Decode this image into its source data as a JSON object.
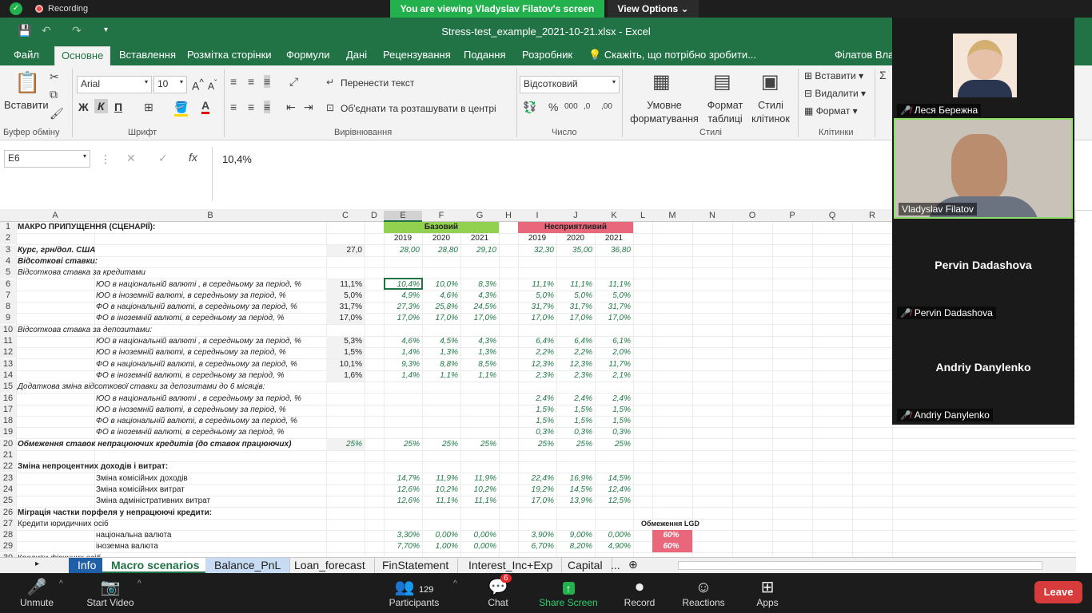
{
  "zoom_top": {
    "recording": "Recording",
    "viewing": "You are viewing Vladyslav Filatov's screen",
    "view_options": "View Options"
  },
  "excel": {
    "title": "Stress-test_example_2021-10-21.xlsx - Excel",
    "menu": [
      "Файл",
      "Основне",
      "Вставлення",
      "Розмітка сторінки",
      "Формули",
      "Дані",
      "Рецензування",
      "Подання",
      "Розробник"
    ],
    "tell_me": "Скажіть, що потрібно зробити...",
    "user": "Філатов Вла",
    "ribbon": {
      "paste": "Вставити",
      "clipboard": "Буфер обміну",
      "font_name": "Arial",
      "font_size": "10",
      "font": "Шрифт",
      "bold": "Ж",
      "italic": "К",
      "underline": "П",
      "wrap": "Перенести текст",
      "merge": "Об'єднати та розташувати в центрі",
      "alignment": "Вирівнювання",
      "number_format": "Відсотковий",
      "number": "Число",
      "cond_format": "Умовне форматування",
      "format_table": "Формат таблиці",
      "cell_styles": "Стилі клітинок",
      "styles": "Стилі",
      "insert": "Вставити",
      "delete": "Видалити",
      "format": "Формат",
      "cells": "Клітинки"
    },
    "name_box": "E6",
    "formula": "10,4%",
    "columns": [
      "A",
      "B",
      "C",
      "D",
      "E",
      "F",
      "G",
      "H",
      "I",
      "J",
      "K",
      "L",
      "M",
      "N",
      "O",
      "P",
      "Q",
      "R"
    ],
    "headers": {
      "base": "Базовий",
      "adverse": "Несприятливий",
      "years": [
        "2019",
        "2020",
        "2021"
      ],
      "lgd": "Обмеження LGD"
    },
    "rows": [
      {
        "n": "1",
        "a": "МАКРО ПРИПУЩЕННЯ (СЦЕНАРІЇ):",
        "b": "",
        "c": "",
        "e": "",
        "f": "",
        "g": "",
        "i": "",
        "j": "",
        "k": ""
      },
      {
        "n": "2",
        "a": "",
        "b": "",
        "c": "",
        "e": "",
        "f": "",
        "g": "",
        "i": "",
        "j": "",
        "k": ""
      },
      {
        "n": "3",
        "a": "Курс, грн/дол. США",
        "b": "",
        "c": "27,0",
        "e": "28,00",
        "f": "28,80",
        "g": "29,10",
        "i": "32,30",
        "j": "35,00",
        "k": "36,80"
      },
      {
        "n": "4",
        "a": "Відсоткові ставки:",
        "b": "",
        "c": "",
        "e": "",
        "f": "",
        "g": "",
        "i": "",
        "j": "",
        "k": ""
      },
      {
        "n": "5",
        "a": "Відсоткова ставка за кредитами",
        "b": "",
        "c": "",
        "e": "",
        "f": "",
        "g": "",
        "i": "",
        "j": "",
        "k": ""
      },
      {
        "n": "6",
        "a": "",
        "b": "ЮО в національній валюті , в середньому за період, %",
        "c": "11,1%",
        "e": "10,4%",
        "f": "10,0%",
        "g": "8,3%",
        "i": "11,1%",
        "j": "11,1%",
        "k": "11,1%"
      },
      {
        "n": "7",
        "a": "",
        "b": "ЮО в іноземній валюті, в середньому за період, %",
        "c": "5,0%",
        "e": "4,9%",
        "f": "4,6%",
        "g": "4,3%",
        "i": "5,0%",
        "j": "5,0%",
        "k": "5,0%"
      },
      {
        "n": "8",
        "a": "",
        "b": "ФО в національній валюті, в середньому за період, %",
        "c": "31,7%",
        "e": "27,3%",
        "f": "25,8%",
        "g": "24,5%",
        "i": "31,7%",
        "j": "31,7%",
        "k": "31,7%"
      },
      {
        "n": "9",
        "a": "",
        "b": "ФО в іноземній валюті, в середньому за період, %",
        "c": "17,0%",
        "e": "17,0%",
        "f": "17,0%",
        "g": "17,0%",
        "i": "17,0%",
        "j": "17,0%",
        "k": "17,0%"
      },
      {
        "n": "10",
        "a": "Відсоткова ставка за депозитами:",
        "b": "",
        "c": "",
        "e": "",
        "f": "",
        "g": "",
        "i": "",
        "j": "",
        "k": ""
      },
      {
        "n": "11",
        "a": "",
        "b": "ЮО в національній валюті , в середньому за період, %",
        "c": "5,3%",
        "e": "4,6%",
        "f": "4,5%",
        "g": "4,3%",
        "i": "6,4%",
        "j": "6,4%",
        "k": "6,1%"
      },
      {
        "n": "12",
        "a": "",
        "b": "ЮО в іноземній валюті, в середньому за період, %",
        "c": "1,5%",
        "e": "1,4%",
        "f": "1,3%",
        "g": "1,3%",
        "i": "2,2%",
        "j": "2,2%",
        "k": "2,0%"
      },
      {
        "n": "13",
        "a": "",
        "b": "ФО в національній валюті, в середньому за період, %",
        "c": "10,1%",
        "e": "9,3%",
        "f": "8,8%",
        "g": "8,5%",
        "i": "12,3%",
        "j": "12,3%",
        "k": "11,7%"
      },
      {
        "n": "14",
        "a": "",
        "b": "ФО в іноземній валюті, в середньому за період, %",
        "c": "1,6%",
        "e": "1,4%",
        "f": "1,1%",
        "g": "1,1%",
        "i": "2,3%",
        "j": "2,3%",
        "k": "2,1%"
      },
      {
        "n": "15",
        "a": "Додаткова зміна відсоткової ставки за депозитами до 6 місяців:",
        "b": "",
        "c": "",
        "e": "",
        "f": "",
        "g": "",
        "i": "",
        "j": "",
        "k": ""
      },
      {
        "n": "16",
        "a": "",
        "b": "ЮО в національній валюті , в середньому за період, %",
        "c": "",
        "e": "",
        "f": "",
        "g": "",
        "i": "2,4%",
        "j": "2,4%",
        "k": "2,4%"
      },
      {
        "n": "17",
        "a": "",
        "b": "ЮО в іноземній валюті, в середньому за період, %",
        "c": "",
        "e": "",
        "f": "",
        "g": "",
        "i": "1,5%",
        "j": "1,5%",
        "k": "1,5%"
      },
      {
        "n": "18",
        "a": "",
        "b": "ФО в національній валюті, в середньому за період, %",
        "c": "",
        "e": "",
        "f": "",
        "g": "",
        "i": "1,5%",
        "j": "1,5%",
        "k": "1,5%"
      },
      {
        "n": "19",
        "a": "",
        "b": "ФО в іноземній валюті, в середньому за період, %",
        "c": "",
        "e": "",
        "f": "",
        "g": "",
        "i": "0,3%",
        "j": "0,3%",
        "k": "0,3%"
      },
      {
        "n": "20",
        "a": "Обмеження ставок непрацюючих кредитів (до ставок працюючих)",
        "b": "",
        "c": "25%",
        "e": "25%",
        "f": "25%",
        "g": "25%",
        "i": "25%",
        "j": "25%",
        "k": "25%"
      },
      {
        "n": "21",
        "a": "",
        "b": "",
        "c": "",
        "e": "",
        "f": "",
        "g": "",
        "i": "",
        "j": "",
        "k": ""
      },
      {
        "n": "22",
        "a": "Зміна непроцентних доходів і витрат:",
        "b": "",
        "c": "",
        "e": "",
        "f": "",
        "g": "",
        "i": "",
        "j": "",
        "k": ""
      },
      {
        "n": "23",
        "a": "",
        "b": "Зміна комісійних доходів",
        "c": "",
        "e": "14,7%",
        "f": "11,9%",
        "g": "11,9%",
        "i": "22,4%",
        "j": "16,9%",
        "k": "14,5%"
      },
      {
        "n": "24",
        "a": "",
        "b": "Зміна комісійних витрат",
        "c": "",
        "e": "12,6%",
        "f": "10,2%",
        "g": "10,2%",
        "i": "19,2%",
        "j": "14,5%",
        "k": "12,4%"
      },
      {
        "n": "25",
        "a": "",
        "b": "Зміна адміністративних витрат",
        "c": "",
        "e": "12,6%",
        "f": "11,1%",
        "g": "11,1%",
        "i": "17,0%",
        "j": "13,9%",
        "k": "12,5%"
      },
      {
        "n": "26",
        "a": "Міграція частки порфеля у непрацюючі кредити:",
        "b": "",
        "c": "",
        "e": "",
        "f": "",
        "g": "",
        "i": "",
        "j": "",
        "k": ""
      },
      {
        "n": "27",
        "a": "Кредити юридичних осіб",
        "b": "",
        "c": "",
        "e": "",
        "f": "",
        "g": "",
        "i": "",
        "j": "",
        "k": ""
      },
      {
        "n": "28",
        "a": "",
        "b": "національна валюта",
        "c": "",
        "e": "3,30%",
        "f": "0,00%",
        "g": "0,00%",
        "i": "3,90%",
        "j": "9,00%",
        "k": "0,00%",
        "m": "60%"
      },
      {
        "n": "29",
        "a": "",
        "b": "іноземна валюта",
        "c": "",
        "e": "7,70%",
        "f": "1,00%",
        "g": "0,00%",
        "i": "6,70%",
        "j": "8,20%",
        "k": "4,90%",
        "m": "60%"
      },
      {
        "n": "30",
        "a": "Кредити фізичних осіб",
        "b": "",
        "c": "",
        "e": "",
        "f": "",
        "g": "",
        "i": "",
        "j": "",
        "k": ""
      }
    ],
    "sheet_tabs": [
      "Info",
      "Macro scenarios",
      "Balance_PnL",
      "Loan_forecast",
      "FinStatement",
      "Interest_Inc+Exp",
      "Capital",
      "..."
    ]
  },
  "participants_panel": [
    {
      "name": "Леся Бережна",
      "muted": true,
      "video": true
    },
    {
      "name": "Vladyslav Filatov",
      "muted": false,
      "video": true
    },
    {
      "name": "Pervin Dadashova",
      "muted": true,
      "video": false
    },
    {
      "name": "Andriy Danylenko",
      "muted": true,
      "video": false
    }
  ],
  "zoom_bar": {
    "unmute": "Unmute",
    "start_video": "Start Video",
    "participants": "Participants",
    "participants_count": "129",
    "chat": "Chat",
    "chat_badge": "6",
    "share": "Share Screen",
    "record": "Record",
    "reactions": "Reactions",
    "apps": "Apps",
    "leave": "Leave"
  }
}
